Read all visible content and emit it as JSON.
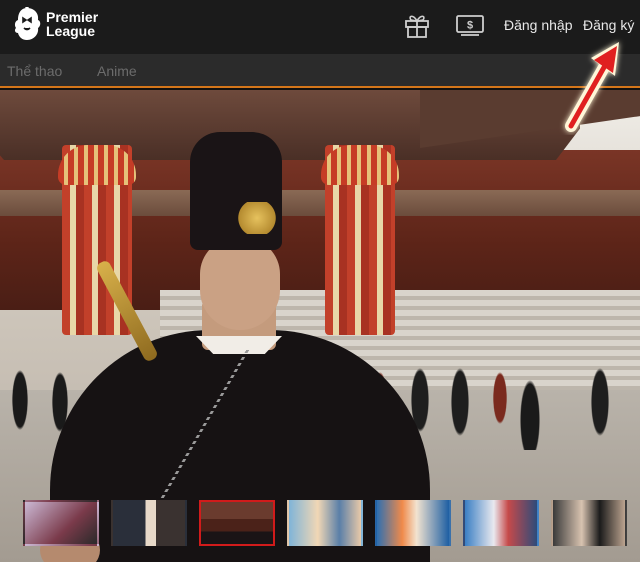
{
  "brand": {
    "line1": "Premier",
    "line2": "League"
  },
  "header": {
    "login_label": "Đăng nhập",
    "register_label": "Đăng ký"
  },
  "nav": {
    "items": [
      "Thể thao",
      "Anime"
    ]
  },
  "icons": {
    "gift": "gift-icon",
    "money": "money-icon"
  },
  "thumbnails": {
    "count": 7,
    "active_index": 2
  },
  "colors": {
    "topbar": "#1b1b1b",
    "navbar": "#2b2b2b",
    "accent": "#d4761a",
    "active_thumb_border": "#d11b1b",
    "annotation": "#e02020"
  }
}
